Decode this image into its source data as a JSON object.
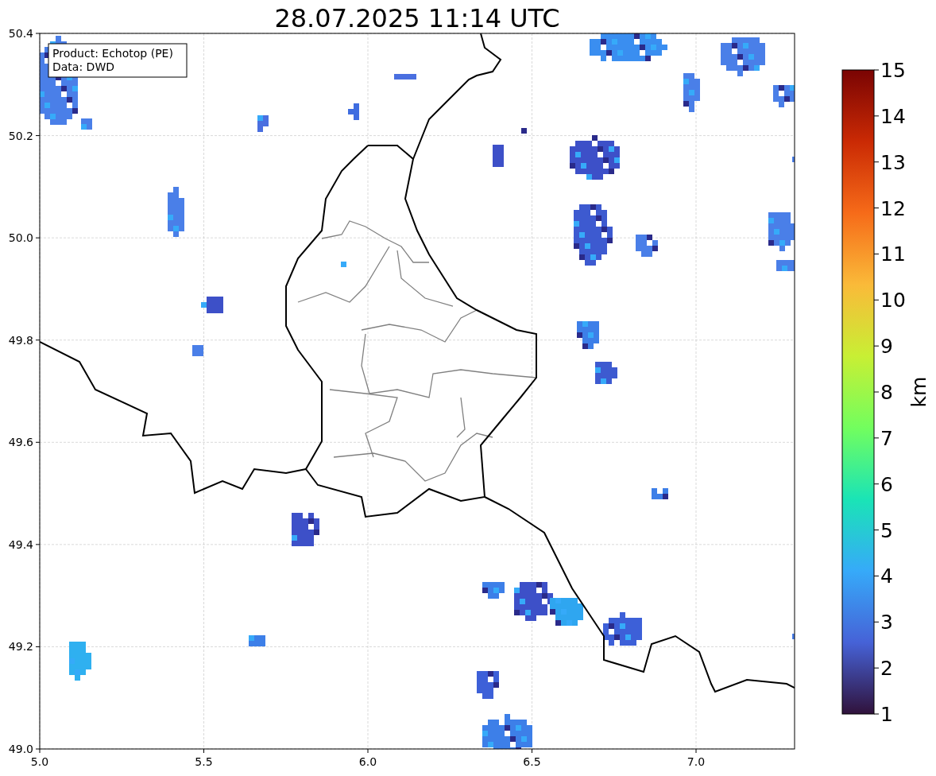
{
  "title": "28.07.2025 11:14 UTC",
  "info_box": [
    "Product: Echotop (PE)",
    "Data: DWD"
  ],
  "x_axis": {
    "ticks": [
      "5.0",
      "5.5",
      "6.0",
      "6.5",
      "7.0"
    ]
  },
  "y_axis": {
    "ticks": [
      "50.4",
      "50.2",
      "50.0",
      "49.8",
      "49.6",
      "49.4",
      "49.2",
      "49.0"
    ]
  },
  "colorbar": {
    "ticks": [
      "15",
      "14",
      "13",
      "12",
      "11",
      "10",
      "9",
      "8",
      "7",
      "6",
      "5",
      "4",
      "3",
      "2",
      "1"
    ],
    "label": "km"
  }
}
